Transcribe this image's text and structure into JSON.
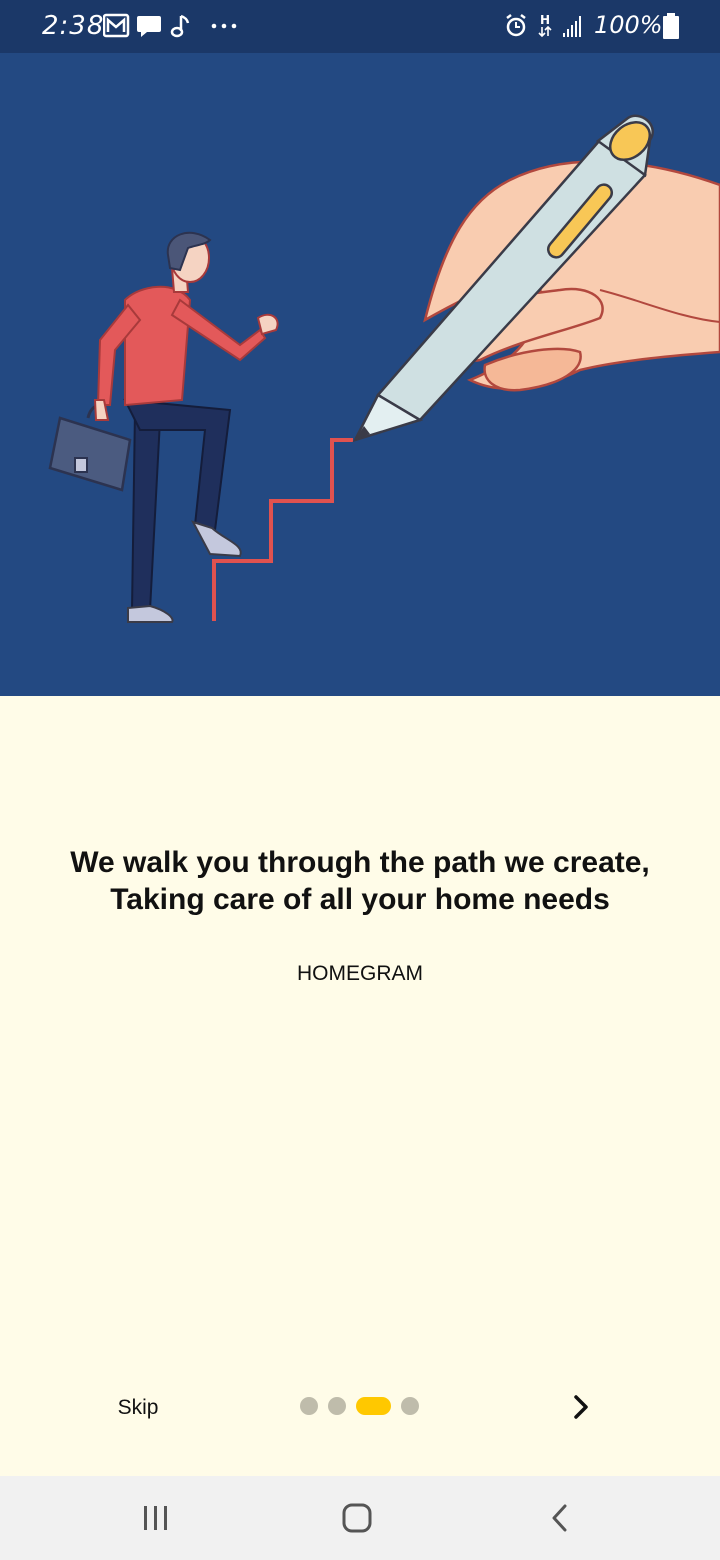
{
  "status_bar": {
    "time": "2:38",
    "battery": "100%",
    "left_icons": [
      "mail-icon",
      "message-icon",
      "music-note-icon",
      "more-dots-icon"
    ],
    "right_icons": [
      "alarm-icon",
      "network-h-icon",
      "signal-icon",
      "battery-icon"
    ]
  },
  "hero": {
    "illustration": "businessman-climbing-drawn-stairs-illustration"
  },
  "onboarding": {
    "headline_line1": "We walk you through the path we create,",
    "headline_line2": "Taking care of all your home needs",
    "brand": "HOMEGRAM",
    "page_index": 3,
    "page_count": 4
  },
  "controls": {
    "skip_label": "Skip",
    "next_icon": "chevron-right-icon"
  },
  "nav_bar": {
    "icons": [
      "recent-apps-icon",
      "home-icon",
      "back-icon"
    ]
  },
  "colors": {
    "status_bar": "#1b3868",
    "hero_bg": "#234982",
    "content_bg": "#fffce8",
    "dot_active": "#ffc800",
    "dot_inactive": "#bfbcab",
    "nav_bg": "#f1f1f1"
  }
}
